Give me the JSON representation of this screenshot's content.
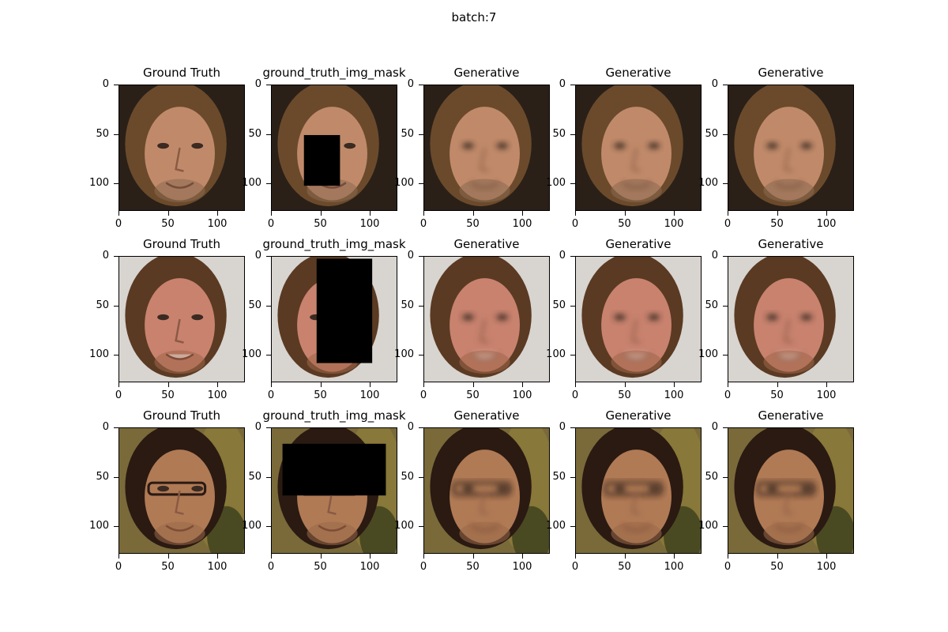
{
  "figure": {
    "suptitle": "batch:7",
    "axis_ticks": {
      "x": [
        "0",
        "50",
        "100"
      ],
      "y": [
        "0",
        "50",
        "100"
      ]
    },
    "rows": [
      {
        "face": "long-haired-man",
        "panels": [
          {
            "title": "Ground Truth",
            "kind": "original"
          },
          {
            "title": "ground_truth_img_mask",
            "kind": "masked"
          },
          {
            "title": "Generative",
            "kind": "generated"
          },
          {
            "title": "Generative",
            "kind": "generated"
          },
          {
            "title": "Generative",
            "kind": "generated"
          }
        ]
      },
      {
        "face": "smiling-man-long-hair",
        "panels": [
          {
            "title": "Ground Truth",
            "kind": "original"
          },
          {
            "title": "ground_truth_img_mask",
            "kind": "masked"
          },
          {
            "title": "Generative",
            "kind": "generated"
          },
          {
            "title": "Generative",
            "kind": "generated"
          },
          {
            "title": "Generative",
            "kind": "generated"
          }
        ]
      },
      {
        "face": "man-with-glasses",
        "panels": [
          {
            "title": "Ground Truth",
            "kind": "original"
          },
          {
            "title": "ground_truth_img_mask",
            "kind": "masked"
          },
          {
            "title": "Generative",
            "kind": "generated"
          },
          {
            "title": "Generative",
            "kind": "generated"
          },
          {
            "title": "Generative",
            "kind": "generated"
          }
        ]
      }
    ]
  }
}
